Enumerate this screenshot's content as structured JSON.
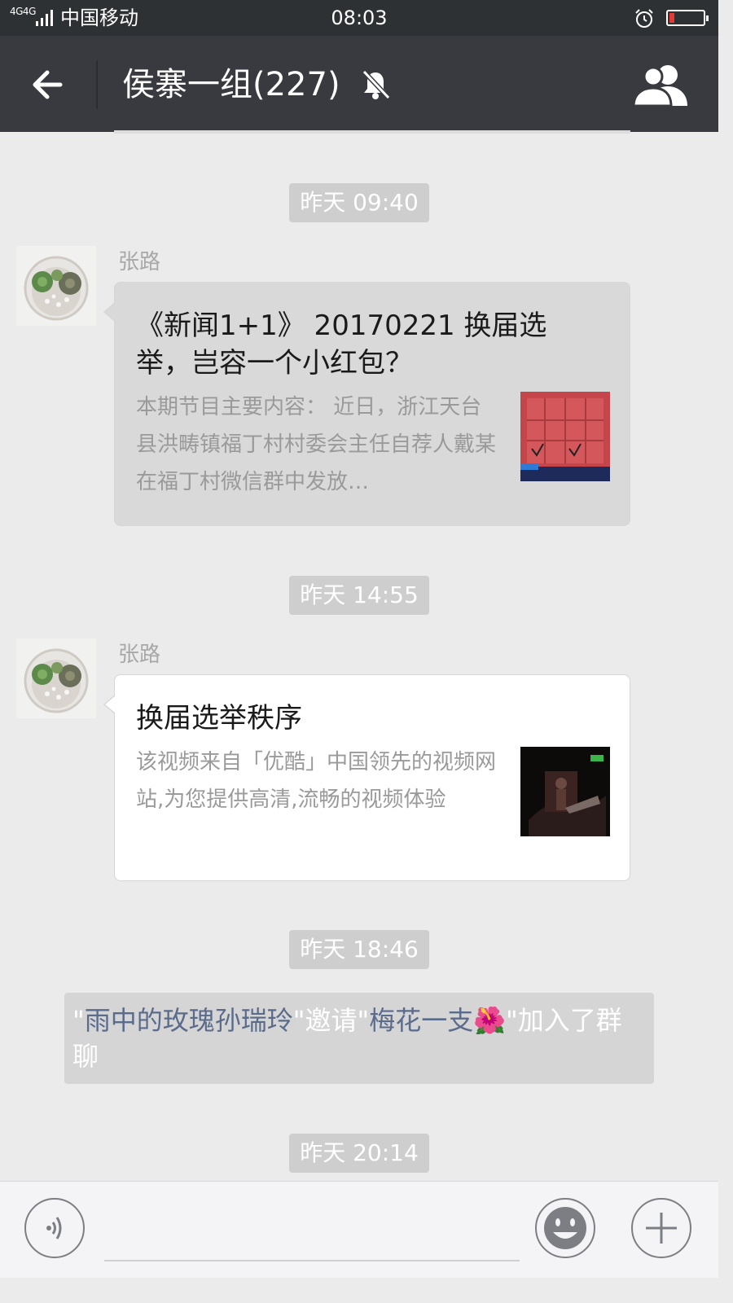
{
  "status_bar": {
    "network": "4G4G",
    "carrier": "中国移动",
    "time": "08:03"
  },
  "header": {
    "title": "侯寨一组(227)"
  },
  "messages": [
    {
      "timestamp": "昨天 09:40",
      "sender": "张路",
      "card_title": "《新闻1+1》 20170221 换届选举，岂容一个小红包？",
      "card_desc": "本期节目主要内容：  近日，浙江天台县洪畴镇福丁村村委会主任自荐人戴某在福丁村微信群中发放…"
    },
    {
      "timestamp": "昨天 14:55",
      "sender": "张路",
      "card_title": "换届选举秩序",
      "card_desc": "该视频来自「优酷」中国领先的视频网站,为您提供高清,流畅的视频体验"
    }
  ],
  "system_message": {
    "timestamp": "昨天 18:46",
    "q1": "\"",
    "inviter": "雨中的玫瑰孙瑞玲",
    "middle": "\"邀请\"",
    "invitee": "梅花一支",
    "emoji": "🌺",
    "end": "\"加入了群聊"
  },
  "last_timestamp": "昨天 20:14",
  "colors": {
    "title_bar": "#393a3f",
    "status_bar": "#2e3134",
    "chat_bg": "#ebebeb",
    "link": "#5b6b8c"
  }
}
